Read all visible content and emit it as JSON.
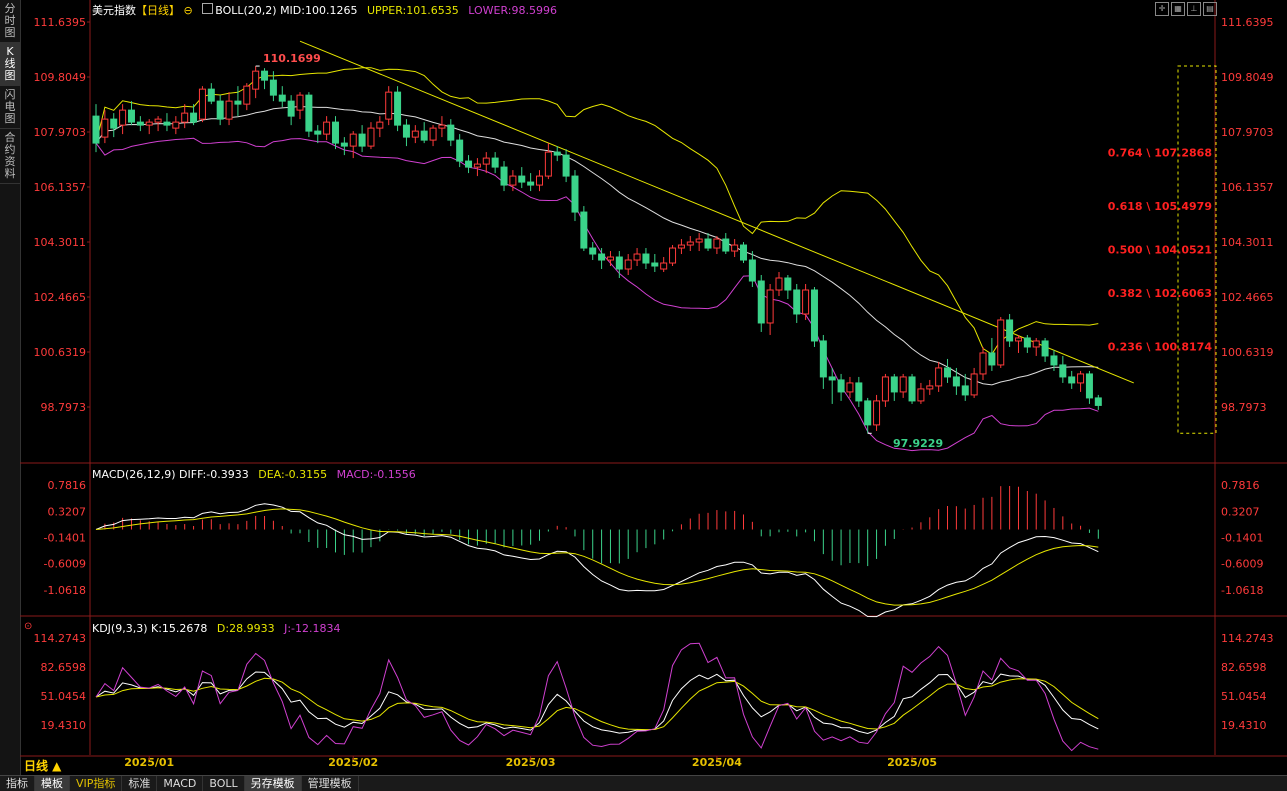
{
  "sidebar": {
    "tabs": [
      {
        "label": "分时图",
        "active": false
      },
      {
        "label": "K线图",
        "active": true
      },
      {
        "label": "闪电图",
        "active": false
      },
      {
        "label": "合约资料",
        "active": false
      }
    ]
  },
  "header": {
    "symbol": "美元指数",
    "period_tag": "【日线】",
    "boll_label": "BOLL(20,2)",
    "mid": "MID:100.1265",
    "upper": "UPPER:101.6535",
    "lower": "LOWER:98.5996"
  },
  "macd_header": {
    "name": "MACD(26,12,9)",
    "diff": "DIFF:-0.3933",
    "dea": "DEA:-0.3155",
    "macd": "MACD:-0.1556"
  },
  "kdj_header": {
    "name": "KDJ(9,3,3)",
    "k": "K:15.2678",
    "d": "D:28.9933",
    "j": "J:-12.1834"
  },
  "price_annotations": {
    "high_label": "110.1699",
    "low_label": "97.9229"
  },
  "fib_levels": [
    {
      "label": "0.764 \\ 107.2868",
      "value": 107.2868
    },
    {
      "label": "0.618 \\ 105.4979",
      "value": 105.4979
    },
    {
      "label": "0.500 \\ 104.0521",
      "value": 104.0521
    },
    {
      "label": "0.382 \\ 102.6063",
      "value": 102.6063
    },
    {
      "label": "0.236 \\ 100.8174",
      "value": 100.8174
    }
  ],
  "period_button": "日线 ▲",
  "bottom_tabs": [
    {
      "label": "指标",
      "active": false,
      "vip": false
    },
    {
      "label": "模板",
      "active": true,
      "vip": false
    },
    {
      "label": "VIP指标",
      "active": false,
      "vip": true
    },
    {
      "label": "标准",
      "active": false,
      "vip": false
    },
    {
      "label": "MACD",
      "active": false,
      "vip": false
    },
    {
      "label": "BOLL",
      "active": false,
      "vip": false
    },
    {
      "label": "另存模板",
      "active": true,
      "vip": false
    },
    {
      "label": "管理模板",
      "active": false,
      "vip": false
    }
  ],
  "toolbar_icons": [
    "crosshair-icon",
    "grid-icon",
    "pin-icon",
    "layout-icon",
    "square-icon"
  ],
  "colors": {
    "up": "#ff3b3b",
    "down": "#3bd38a",
    "boll_mid": "#dddddd",
    "boll_upper": "#e6e600",
    "boll_lower": "#d040d0",
    "trendline": "#e6e600",
    "axis_text": "#ff3b3b",
    "fib_text": "#ff2020"
  },
  "chart_data": [
    {
      "type": "candlestick",
      "title": "美元指数 日线",
      "y_ticks": [
        "111.6395",
        "109.8049",
        "107.9703",
        "106.1357",
        "104.3011",
        "102.4665",
        "100.6319",
        "98.7973"
      ],
      "ylim": [
        97.2,
        111.9
      ],
      "x_ticks": [
        "2025/01",
        "2025/02",
        "2025/03",
        "2025/04",
        "2025/05"
      ],
      "ohlc": [
        [
          108.5,
          108.9,
          107.3,
          107.6
        ],
        [
          107.8,
          108.7,
          107.6,
          108.4
        ],
        [
          108.4,
          108.6,
          107.8,
          108.1
        ],
        [
          108.2,
          108.9,
          107.9,
          108.7
        ],
        [
          108.7,
          109.0,
          108.2,
          108.3
        ],
        [
          108.3,
          108.5,
          108.0,
          108.2
        ],
        [
          108.2,
          108.4,
          107.9,
          108.3
        ],
        [
          108.3,
          108.5,
          108.0,
          108.4
        ],
        [
          108.3,
          108.6,
          108.0,
          108.2
        ],
        [
          108.1,
          108.5,
          107.9,
          108.3
        ],
        [
          108.3,
          108.9,
          108.1,
          108.6
        ],
        [
          108.6,
          108.9,
          108.2,
          108.3
        ],
        [
          108.4,
          109.5,
          108.3,
          109.4
        ],
        [
          109.4,
          109.6,
          108.9,
          109.0
        ],
        [
          109.0,
          109.2,
          108.2,
          108.4
        ],
        [
          108.4,
          109.3,
          108.2,
          109.0
        ],
        [
          109.0,
          109.5,
          108.5,
          108.9
        ],
        [
          108.9,
          109.6,
          108.7,
          109.5
        ],
        [
          109.4,
          110.17,
          109.1,
          110.0
        ],
        [
          110.0,
          110.1,
          109.4,
          109.7
        ],
        [
          109.7,
          110.0,
          109.0,
          109.2
        ],
        [
          109.2,
          109.5,
          108.8,
          109.0
        ],
        [
          109.0,
          109.2,
          108.2,
          108.5
        ],
        [
          108.7,
          109.3,
          108.4,
          109.2
        ],
        [
          109.2,
          109.3,
          107.8,
          108.0
        ],
        [
          108.0,
          108.2,
          107.6,
          107.9
        ],
        [
          107.9,
          108.5,
          107.7,
          108.3
        ],
        [
          108.3,
          108.5,
          107.4,
          107.6
        ],
        [
          107.6,
          107.8,
          107.2,
          107.5
        ],
        [
          107.5,
          108.0,
          107.1,
          107.9
        ],
        [
          107.9,
          108.2,
          107.3,
          107.5
        ],
        [
          107.5,
          108.3,
          107.4,
          108.1
        ],
        [
          108.1,
          108.5,
          107.8,
          108.3
        ],
        [
          108.4,
          109.5,
          108.2,
          109.3
        ],
        [
          109.3,
          109.5,
          108.0,
          108.2
        ],
        [
          108.2,
          108.4,
          107.5,
          107.8
        ],
        [
          107.8,
          108.2,
          107.6,
          108.0
        ],
        [
          108.0,
          108.3,
          107.6,
          107.7
        ],
        [
          107.7,
          108.2,
          107.5,
          108.1
        ],
        [
          108.1,
          108.5,
          107.8,
          108.2
        ],
        [
          108.2,
          108.4,
          107.5,
          107.7
        ],
        [
          107.7,
          107.9,
          106.8,
          107.0
        ],
        [
          107.0,
          107.2,
          106.6,
          106.8
        ],
        [
          106.8,
          107.1,
          106.5,
          106.9
        ],
        [
          106.9,
          107.3,
          106.6,
          107.1
        ],
        [
          107.1,
          107.3,
          106.6,
          106.8
        ],
        [
          106.8,
          107.0,
          106.0,
          106.2
        ],
        [
          106.2,
          106.7,
          106.0,
          106.5
        ],
        [
          106.5,
          106.8,
          106.1,
          106.3
        ],
        [
          106.3,
          106.6,
          106.0,
          106.2
        ],
        [
          106.2,
          106.7,
          106.0,
          106.5
        ],
        [
          106.5,
          107.6,
          106.4,
          107.3
        ],
        [
          107.3,
          107.5,
          107.0,
          107.2
        ],
        [
          107.2,
          107.4,
          106.3,
          106.5
        ],
        [
          106.5,
          106.7,
          105.0,
          105.3
        ],
        [
          105.3,
          105.5,
          104.0,
          104.1
        ],
        [
          104.1,
          104.3,
          103.7,
          103.9
        ],
        [
          103.9,
          104.1,
          103.4,
          103.7
        ],
        [
          103.7,
          104.0,
          103.5,
          103.8
        ],
        [
          103.8,
          104.0,
          103.1,
          103.4
        ],
        [
          103.4,
          103.9,
          103.2,
          103.7
        ],
        [
          103.7,
          104.1,
          103.5,
          103.9
        ],
        [
          103.9,
          104.1,
          103.4,
          103.6
        ],
        [
          103.6,
          103.9,
          103.3,
          103.5
        ],
        [
          103.4,
          103.8,
          103.3,
          103.6
        ],
        [
          103.6,
          104.2,
          103.5,
          104.1
        ],
        [
          104.1,
          104.4,
          103.9,
          104.2
        ],
        [
          104.2,
          104.5,
          104.0,
          104.3
        ],
        [
          104.3,
          104.6,
          104.0,
          104.4
        ],
        [
          104.4,
          104.6,
          104.0,
          104.1
        ],
        [
          104.1,
          104.5,
          103.9,
          104.4
        ],
        [
          104.4,
          104.6,
          103.9,
          104.0
        ],
        [
          104.0,
          104.4,
          103.8,
          104.2
        ],
        [
          104.2,
          104.3,
          103.6,
          103.7
        ],
        [
          103.7,
          104.0,
          102.8,
          103.0
        ],
        [
          103.0,
          103.2,
          101.3,
          101.6
        ],
        [
          101.6,
          102.9,
          101.2,
          102.7
        ],
        [
          102.7,
          103.3,
          102.5,
          103.1
        ],
        [
          103.1,
          103.2,
          102.4,
          102.7
        ],
        [
          102.7,
          102.9,
          101.6,
          101.9
        ],
        [
          101.9,
          102.9,
          101.7,
          102.7
        ],
        [
          102.7,
          102.8,
          100.8,
          101.0
        ],
        [
          101.0,
          101.2,
          99.4,
          99.8
        ],
        [
          99.8,
          100.1,
          98.9,
          99.7
        ],
        [
          99.7,
          99.9,
          99.0,
          99.3
        ],
        [
          99.3,
          99.8,
          99.1,
          99.6
        ],
        [
          99.6,
          99.8,
          98.8,
          99.0
        ],
        [
          99.0,
          99.1,
          97.92,
          98.2
        ],
        [
          98.2,
          99.2,
          98.0,
          99.0
        ],
        [
          99.0,
          99.9,
          98.8,
          99.8
        ],
        [
          99.8,
          99.9,
          99.0,
          99.3
        ],
        [
          99.3,
          99.9,
          99.1,
          99.8
        ],
        [
          99.8,
          99.9,
          98.9,
          99.0
        ],
        [
          99.0,
          99.6,
          98.9,
          99.4
        ],
        [
          99.4,
          99.7,
          99.2,
          99.5
        ],
        [
          99.5,
          100.3,
          99.3,
          100.1
        ],
        [
          100.1,
          100.4,
          99.6,
          99.8
        ],
        [
          99.8,
          100.1,
          99.2,
          99.5
        ],
        [
          99.5,
          99.9,
          99.0,
          99.2
        ],
        [
          99.2,
          100.1,
          99.1,
          99.9
        ],
        [
          99.9,
          100.8,
          99.7,
          100.6
        ],
        [
          100.6,
          101.1,
          100.0,
          100.2
        ],
        [
          100.2,
          101.8,
          100.1,
          101.7
        ],
        [
          101.7,
          101.9,
          100.8,
          101.0
        ],
        [
          101.0,
          101.2,
          100.6,
          101.1
        ],
        [
          101.1,
          101.2,
          100.6,
          100.8
        ],
        [
          100.8,
          101.1,
          100.5,
          101.0
        ],
        [
          101.0,
          101.1,
          100.3,
          100.5
        ],
        [
          100.5,
          100.7,
          100.0,
          100.2
        ],
        [
          100.2,
          100.5,
          99.6,
          99.8
        ],
        [
          99.8,
          100.0,
          99.4,
          99.6
        ],
        [
          99.6,
          100.0,
          99.3,
          99.9
        ],
        [
          99.9,
          100.0,
          98.9,
          99.1
        ],
        [
          99.1,
          99.2,
          98.7,
          98.85
        ]
      ],
      "annotations": [
        {
          "text": "110.1699",
          "at_index": 18
        },
        {
          "text": "97.9229",
          "at_index": 87
        }
      ],
      "series": [
        {
          "name": "MID",
          "color": "#dddddd"
        },
        {
          "name": "UPPER",
          "color": "#e6e600"
        },
        {
          "name": "LOWER",
          "color": "#d040d0"
        }
      ],
      "trendline": {
        "from": {
          "index": 23,
          "value": 111.0
        },
        "to": {
          "index": 117,
          "value": 99.6
        }
      }
    },
    {
      "type": "line",
      "title": "MACD(26,12,9)",
      "y_ticks": [
        "0.7816",
        "0.3207",
        "-0.1401",
        "-0.6009",
        "-1.0618"
      ],
      "ylim": [
        -1.35,
        0.92
      ],
      "series": [
        {
          "name": "DIFF",
          "last": -0.3933,
          "color": "#ffffff"
        },
        {
          "name": "DEA",
          "last": -0.3155,
          "color": "#e6e600"
        },
        {
          "name": "MACD",
          "last": -0.1556,
          "color": "#d040d0"
        }
      ]
    },
    {
      "type": "line",
      "title": "KDJ(9,3,3)",
      "y_ticks": [
        "114.2743",
        "82.6598",
        "51.0454",
        "19.4310"
      ],
      "ylim": [
        -18,
        122
      ],
      "series": [
        {
          "name": "K",
          "last": 15.2678,
          "color": "#ffffff"
        },
        {
          "name": "D",
          "last": 28.9933,
          "color": "#e6e600"
        },
        {
          "name": "J",
          "last": -12.1834,
          "color": "#d040d0"
        }
      ]
    }
  ]
}
